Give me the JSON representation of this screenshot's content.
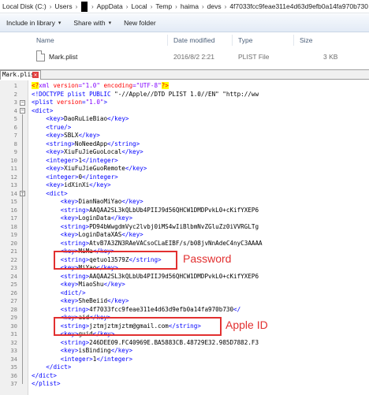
{
  "breadcrumb": [
    "Local Disk (C:)",
    "Users",
    "AppData",
    "Local",
    "Temp",
    "haima",
    "devs",
    "4f7033fcc9feae311e4d63d9efb0a14fa970b730"
  ],
  "toolbar": {
    "include_label": "Include in library",
    "share_label": "Share with",
    "newfolder_label": "New folder"
  },
  "file_list": {
    "columns": [
      "Name",
      "Date modified",
      "Type",
      "Size"
    ],
    "rows": [
      {
        "name": "Mark.plist",
        "date": "2016/8/2 2:21",
        "type": "PLIST File",
        "size": "3 KB"
      }
    ]
  },
  "editor": {
    "tab_label": "Mark.plist",
    "lines": [
      {
        "n": "1",
        "fold": "",
        "html": "<span class='pibox'>&lt;?</span><span class='pi'>xml </span><span class='at'>version</span><span class='pi'>=</span><span class='av'>\"1.0\"</span><span class='pi'> </span><span class='at'>encoding</span><span class='pi'>=</span><span class='av'>\"UTF-8\"</span><span class='pibox'>?&gt;</span>"
      },
      {
        "n": "2",
        "fold": "",
        "html": "<span class='tg'>&lt;!DOCTYPE plist PUBLIC </span><span class='dt'>\"-//Apple//DTD PLIST 1.0//EN\" \"http://ww</span>"
      },
      {
        "n": "3",
        "fold": "-",
        "html": "<span class='tg'>&lt;plist </span><span class='at'>version</span><span class='tg'>=</span><span class='av'>\"1.0\"</span><span class='tg'>&gt;</span>"
      },
      {
        "n": "4",
        "fold": "-",
        "html": "<span class='tg'>&lt;dict&gt;</span>"
      },
      {
        "n": "5",
        "fold": "",
        "html": "    <span class='tg'>&lt;key&gt;</span>DaoRuLieBiao<span class='tg'>&lt;/key&gt;</span>"
      },
      {
        "n": "6",
        "fold": "",
        "html": "    <span class='tg'>&lt;true/&gt;</span>"
      },
      {
        "n": "7",
        "fold": "",
        "html": "    <span class='tg'>&lt;key&gt;</span>SBLX<span class='tg'>&lt;/key&gt;</span>"
      },
      {
        "n": "8",
        "fold": "",
        "html": "    <span class='tg'>&lt;string&gt;</span>NoNeedApp<span class='tg'>&lt;/string&gt;</span>"
      },
      {
        "n": "9",
        "fold": "",
        "html": "    <span class='tg'>&lt;key&gt;</span>XiuFuJieGuoLocal<span class='tg'>&lt;/key&gt;</span>"
      },
      {
        "n": "10",
        "fold": "",
        "html": "    <span class='tg'>&lt;integer&gt;</span>1<span class='tg'>&lt;/integer&gt;</span>"
      },
      {
        "n": "11",
        "fold": "",
        "html": "    <span class='tg'>&lt;key&gt;</span>XiuFuJieGuoRemote<span class='tg'>&lt;/key&gt;</span>"
      },
      {
        "n": "12",
        "fold": "",
        "html": "    <span class='tg'>&lt;integer&gt;</span>0<span class='tg'>&lt;/integer&gt;</span>"
      },
      {
        "n": "13",
        "fold": "",
        "html": "    <span class='tg'>&lt;key&gt;</span>idXinXi<span class='tg'>&lt;/key&gt;</span>"
      },
      {
        "n": "14",
        "fold": "-",
        "html": "    <span class='tg'>&lt;dict&gt;</span>"
      },
      {
        "n": "15",
        "fold": "",
        "html": "        <span class='tg'>&lt;key&gt;</span>DianNaoMiYao<span class='tg'>&lt;/key&gt;</span>"
      },
      {
        "n": "16",
        "fold": "",
        "html": "        <span class='tg'>&lt;string&gt;</span>AAQAA2SL3kQLbUb4PIIJ9d56QHCW1DMDPvkL0+cKifYXEP6"
      },
      {
        "n": "17",
        "fold": "",
        "html": "        <span class='tg'>&lt;key&gt;</span>LoginData<span class='tg'>&lt;/key&gt;</span>"
      },
      {
        "n": "18",
        "fold": "",
        "html": "        <span class='tg'>&lt;string&gt;</span>PD94bWwgdmVyc2lvbj0iMS4wIiBlbmNvZGluZz0iVVRGLTg"
      },
      {
        "n": "19",
        "fold": "",
        "html": "        <span class='tg'>&lt;key&gt;</span>LoginDataXAS<span class='tg'>&lt;/key&gt;</span>"
      },
      {
        "n": "20",
        "fold": "",
        "html": "        <span class='tg'>&lt;string&gt;</span>AtvB7A3ZN3RAeVACsoCLaEIBF/s/b08jvNnAdeC4nyC3AAAA"
      },
      {
        "n": "21",
        "fold": "",
        "html": "        <span class='tg'>&lt;key&gt;</span>MiMa<span class='tg'>&lt;/key&gt;</span>"
      },
      {
        "n": "22",
        "fold": "",
        "html": "        <span class='tg'>&lt;string&gt;</span>qetuo13579Z<span class='tg'>&lt;/string&gt;</span>"
      },
      {
        "n": "23",
        "fold": "",
        "html": "        <span class='tg'>&lt;key&gt;</span>MiYao<span class='tg'>&lt;/key&gt;</span>"
      },
      {
        "n": "24",
        "fold": "",
        "html": "        <span class='tg'>&lt;string&gt;</span>AAQAA2SL3kQLbUb4PIIJ9d56QHCW1DMDPvkL0+cKifYXEP6"
      },
      {
        "n": "25",
        "fold": "",
        "html": "        <span class='tg'>&lt;key&gt;</span>MiaoShu<span class='tg'>&lt;/key&gt;</span>"
      },
      {
        "n": "26",
        "fold": "",
        "html": "        <span class='tg'>&lt;dict/&gt;</span>"
      },
      {
        "n": "27",
        "fold": "",
        "html": "        <span class='tg'>&lt;key&gt;</span>SheBeiid<span class='tg'>&lt;/key&gt;</span>"
      },
      {
        "n": "28",
        "fold": "",
        "html": "        <span class='tg'>&lt;string&gt;</span>4f7033fcc9feae311e4d63d9efb0a14fa970b730<span class='tg'>&lt;/</span>"
      },
      {
        "n": "29",
        "fold": "",
        "html": "        <span class='tg'>&lt;key&gt;</span>aid<span class='tg'>&lt;/key&gt;</span>"
      },
      {
        "n": "30",
        "fold": "",
        "html": "        <span class='tg'>&lt;string&gt;</span>jztmjztmjztm@gmail.com<span class='tg'>&lt;/string&gt;</span>"
      },
      {
        "n": "31",
        "fold": "",
        "html": "        <span class='tg'>&lt;key&gt;</span>guid<span class='tg'>&lt;/key&gt;</span>"
      },
      {
        "n": "32",
        "fold": "",
        "html": "        <span class='tg'>&lt;string&gt;</span>246DEE09.FC40969E.BA5883CB.48729E32.985D7882.F3"
      },
      {
        "n": "33",
        "fold": "",
        "html": "        <span class='tg'>&lt;key&gt;</span>isBinding<span class='tg'>&lt;/key&gt;</span>"
      },
      {
        "n": "34",
        "fold": "",
        "html": "        <span class='tg'>&lt;integer&gt;</span>1<span class='tg'>&lt;/integer&gt;</span>"
      },
      {
        "n": "35",
        "fold": "",
        "html": "    <span class='tg'>&lt;/dict&gt;</span>"
      },
      {
        "n": "36",
        "fold": "",
        "html": "<span class='tg'>&lt;/dict&gt;</span>"
      },
      {
        "n": "37",
        "fold": "",
        "html": "<span class='tg'>&lt;/plist&gt;</span>"
      }
    ]
  },
  "annotations": {
    "password_label": "Password",
    "appleid_label": "Apple ID",
    "color": "#e23030"
  }
}
